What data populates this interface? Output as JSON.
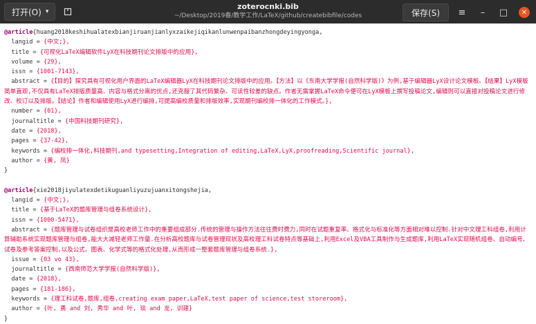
{
  "toolbar": {
    "open_label": "打开(O)",
    "open_caret": "▾",
    "save_label": "保存(S)",
    "menu_glyph": "≡",
    "minimize_glyph": "–",
    "maximize_glyph": "□",
    "close_glyph": "✕"
  },
  "window": {
    "filename": "zoterocnki.bib",
    "path": "~/Desktop/2019春/教学工作/LaTeX/github/createbibfile/codes"
  },
  "entries": [
    {
      "type": "@article",
      "key": "{huang2018keshihualatexbianjiruanjianlyxzaikejiqikanlunwenpaibanzhongdeyingyonga,",
      "fields": [
        {
          "name": "langid = ",
          "value": "{中文;},"
        },
        {
          "name": "title = ",
          "value": "{可视化LaTeX编辑软件LyX在科技期刊论文排版中的应用},"
        },
        {
          "name": "volume = ",
          "value": "{29},"
        },
        {
          "name": "issn = ",
          "value": "{1001-7143},"
        },
        {
          "name": "abstract = ",
          "value": "{【目的】探究具有可视化用户界面的LaTeX编辑器LyX在科技期刊论文排版中的应用。【方法】以《东南大学学报(自然科学版)》为例,基于编辑器LyX设计论文模板。【结果】LyX模板简单直观,不仅具有LaTeX排版质量高、内容与格式分离的优点,还克服了其代码繁杂、可读性较差的缺点。作者无需掌握LaTeX命令便可在LyX模板上撰写投稿论文,编辑则可以直接对投稿论文进行修改、校订以及排版。【结论】作者和编辑使用LyX进行编排,可提高编校质量和排版效率,实现期刊编校排一体化的工作模式。},"
        },
        {
          "name": "number = ",
          "value": "{01},"
        },
        {
          "name": "journaltitle = ",
          "value": "{中国科技期刊研究},"
        },
        {
          "name": "date = ",
          "value": "{2018},"
        },
        {
          "name": "pages = ",
          "value": "{37-42},"
        },
        {
          "name": "keywords = ",
          "value": "{编校排一体化,科技期刊,and typesetting,Integration of editing,LaTeX,LyX,proofreading,Scientific journal},"
        },
        {
          "name": "author = ",
          "value": "{黄, 凤}"
        }
      ],
      "close": "}"
    },
    {
      "type": "@article",
      "key": "{xie2018jiyulatexdetikuguanliyuzujuanxitongshejia,",
      "fields": [
        {
          "name": "langid = ",
          "value": "{中文;},"
        },
        {
          "name": "title = ",
          "value": "{基于LaTeX的题库管理与组卷系统设计},"
        },
        {
          "name": "issn = ",
          "value": "{1000-5471},"
        },
        {
          "name": "abstract = ",
          "value": "{题库管理与试卷组织是高校老师工作中的重要组成部分.传统的管理与操作方法往往费时费力,同时在试题重复率、格式化与标准化等方面相对难以控制.针对中文理工科组卷,利用计算辅助系统实现题库管理与组卷,能大大减轻老师工作量.在分析高校题库与试卷管理现状及高校理工科试卷特点等基础上,利用Excel及VBA工具制作与生成题库,利用LaTeX实现随机组卷、自动编号、试卷及参考答案控制,以及公式、图表、化学式等的格式化处理,从而形成一整套题库管理与组卷系统.},"
        },
        {
          "name": "issue = ",
          "value": "{03 vo 43},"
        },
        {
          "name": "journaltitle = ",
          "value": "{西南师范大学学报(自然科学版)},"
        },
        {
          "name": "date = ",
          "value": "{2018},"
        },
        {
          "name": "pages = ",
          "value": "{181-186},"
        },
        {
          "name": "keywords = ",
          "value": "{理工科试卷,题库,组卷,creating exam paper,LaTeX,test paper of science,test storeroom},"
        },
        {
          "name": "author = ",
          "value": "{叶, 勇 and 刘, 秀华 and 叶, 琰 and 龙, 训建}"
        }
      ],
      "close": "}"
    }
  ]
}
